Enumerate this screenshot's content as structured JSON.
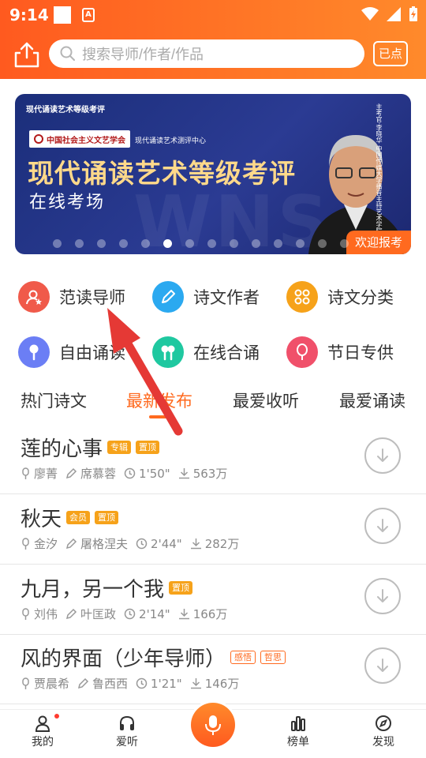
{
  "status": {
    "time": "9:14",
    "app_icon": "A"
  },
  "search": {
    "placeholder": "搜索导师/作者/作品"
  },
  "checkin": {
    "label": "已点"
  },
  "banner": {
    "small_title": "现代诵读艺术等级考评",
    "org": "中国社会主义文艺学会",
    "center": "现代诵读艺术测评中心",
    "title": "现代诵读艺术等级考评",
    "subtitle": "在线考场",
    "vertical_text": "主考官·李晓华 中国传媒大学播音主持艺术学院院长",
    "cta": "欢迎报考",
    "watermark": "WNS",
    "dots": 14,
    "active_dot": 5
  },
  "categories": [
    {
      "label": "范读导师",
      "icon": "teacher-icon",
      "color": "#f05a4a"
    },
    {
      "label": "诗文作者",
      "icon": "pen-icon",
      "color": "#2ba9f0"
    },
    {
      "label": "诗文分类",
      "icon": "grid-icon",
      "color": "#f6a21a"
    },
    {
      "label": "自由诵读",
      "icon": "microphone-icon",
      "color": "#6b7ef5"
    },
    {
      "label": "在线合诵",
      "icon": "duet-mic-icon",
      "color": "#1fc8a0"
    },
    {
      "label": "节日专供",
      "icon": "balloon-icon",
      "color": "#f0506a"
    }
  ],
  "tabs": [
    "热门诗文",
    "最新发布",
    "最爱收听",
    "最爱诵读"
  ],
  "active_tab": 1,
  "works": [
    {
      "title": "莲的心事",
      "tags": [
        {
          "text": "专辑",
          "style": "orange"
        },
        {
          "text": "置顶",
          "style": "orange"
        }
      ],
      "reader": "廖菁",
      "author": "席慕蓉",
      "duration": "1'50\"",
      "downloads": "563万"
    },
    {
      "title": "秋天",
      "tags": [
        {
          "text": "会员",
          "style": "orange"
        },
        {
          "text": "置顶",
          "style": "orange"
        }
      ],
      "reader": "金汐",
      "author": "屠格涅夫",
      "duration": "2'44\"",
      "downloads": "282万"
    },
    {
      "title": "九月，另一个我",
      "tags": [
        {
          "text": "置顶",
          "style": "orange"
        }
      ],
      "reader": "刘伟",
      "author": "叶匡政",
      "duration": "2'14\"",
      "downloads": "166万"
    },
    {
      "title": "风的界面（少年导师）",
      "tags": [
        {
          "text": "感悟",
          "style": "outline"
        },
        {
          "text": "哲思",
          "style": "outline"
        }
      ],
      "reader": "贾晨希",
      "author": "鲁西西",
      "duration": "1'21\"",
      "downloads": "146万"
    }
  ],
  "nav": [
    {
      "label": "我的",
      "icon": "profile-icon",
      "badge": true
    },
    {
      "label": "爱听",
      "icon": "headphones-icon"
    },
    {
      "label": "榜单",
      "icon": "chart-icon"
    },
    {
      "label": "发现",
      "icon": "compass-icon"
    }
  ],
  "colors": {
    "accent": "#ff6a1f",
    "header_start": "#ff5a1f",
    "header_end": "#ff8a2b",
    "tag": "#f6a21a"
  }
}
